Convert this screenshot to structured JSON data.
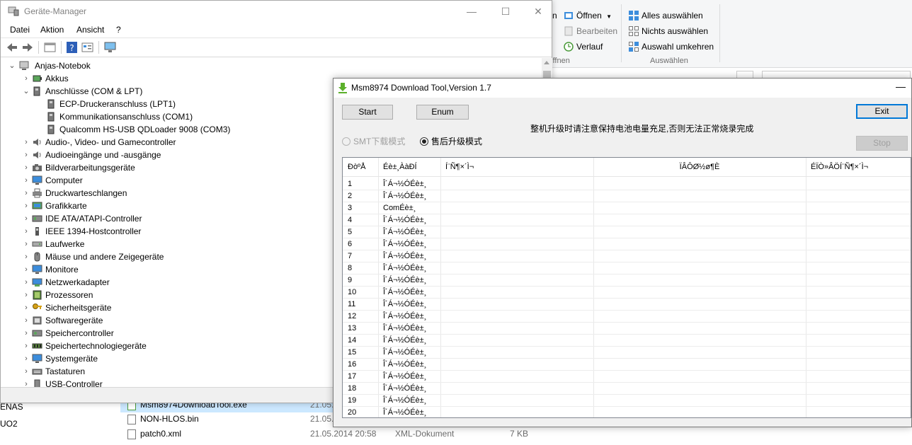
{
  "explorer": {
    "ribbon": {
      "open_label": "Öffnen",
      "edit_label": "Bearbeiten",
      "history_label": "Verlauf",
      "open_group_caption": "Öffnen",
      "select_all_label": "Alles auswählen",
      "select_none_label": "Nichts auswählen",
      "invert_selection_label": "Auswahl umkehren",
      "select_group_caption": "Auswählen",
      "new_partial": "n"
    },
    "nav_items": [
      "ENAS",
      "UO2"
    ],
    "files": [
      {
        "name": "Msm8974DownloadTool.exe",
        "date": "21.05.",
        "type": "",
        "size": ""
      },
      {
        "name": "NON-HLOS.bin",
        "date": "21.05.",
        "type": "",
        "size": ""
      },
      {
        "name": "patch0.xml",
        "date": "21.05.2014 20:58",
        "type": "XML-Dokument",
        "size": "7 KB"
      }
    ]
  },
  "devmgr": {
    "title": "Geräte-Manager",
    "menu": [
      "Datei",
      "Aktion",
      "Ansicht",
      "?"
    ],
    "window_controls": {
      "minimize": "—",
      "maximize": "☐",
      "close": "✕"
    },
    "tree": {
      "root": "Anjas-Notebok",
      "categories": [
        {
          "label": "Akkus",
          "expanded": false
        },
        {
          "label": "Anschlüsse (COM & LPT)",
          "expanded": true,
          "children": [
            "ECP-Druckeranschluss (LPT1)",
            "Kommunikationsanschluss (COM1)",
            "Qualcomm HS-USB QDLoader 9008 (COM3)"
          ]
        },
        {
          "label": "Audio-, Video- und Gamecontroller",
          "expanded": false
        },
        {
          "label": "Audioeingänge und -ausgänge",
          "expanded": false
        },
        {
          "label": "Bildverarbeitungsgeräte",
          "expanded": false
        },
        {
          "label": "Computer",
          "expanded": false
        },
        {
          "label": "Druckwarteschlangen",
          "expanded": false
        },
        {
          "label": "Grafikkarte",
          "expanded": false
        },
        {
          "label": "IDE ATA/ATAPI-Controller",
          "expanded": false
        },
        {
          "label": "IEEE 1394-Hostcontroller",
          "expanded": false
        },
        {
          "label": "Laufwerke",
          "expanded": false
        },
        {
          "label": "Mäuse und andere Zeigegeräte",
          "expanded": false
        },
        {
          "label": "Monitore",
          "expanded": false
        },
        {
          "label": "Netzwerkadapter",
          "expanded": false
        },
        {
          "label": "Prozessoren",
          "expanded": false
        },
        {
          "label": "Sicherheitsgeräte",
          "expanded": false
        },
        {
          "label": "Softwaregeräte",
          "expanded": false
        },
        {
          "label": "Speichercontroller",
          "expanded": false
        },
        {
          "label": "Speichertechnologiegeräte",
          "expanded": false
        },
        {
          "label": "Systemgeräte",
          "expanded": false
        },
        {
          "label": "Tastaturen",
          "expanded": false
        },
        {
          "label": "USB-Controller",
          "expanded": false
        }
      ]
    }
  },
  "dltool": {
    "title": "Msm8974 Download Tool,Version 1.7",
    "minimize": "—",
    "start_label": "Start",
    "enum_label": "Enum",
    "exit_label": "Exit",
    "stop_label": "Stop",
    "warning": "整机升级时请注意保持电池电量充足,否则无法正常烧录完成",
    "mode_smt": "SMT下载模式",
    "mode_aftersale": "售后升级模式",
    "selected_mode": "aftersale",
    "grid": {
      "headers": [
        "ÐòºÅ",
        "Éè±¸ÀàÐÍ",
        "Í¨Ñ¶×´Ì¬",
        "ÏÂÔØ½ø¶È",
        "ÉÏÒ»ÂÖÍ¨Ñ¶×´Ì¬"
      ],
      "rows": [
        {
          "no": "1",
          "type": "Î´Á¬½ÓÉè±¸"
        },
        {
          "no": "2",
          "type": "Î´Á¬½ÓÉè±¸"
        },
        {
          "no": "3",
          "type": "ComÉè±¸"
        },
        {
          "no": "4",
          "type": "Î´Á¬½ÓÉè±¸"
        },
        {
          "no": "5",
          "type": "Î´Á¬½ÓÉè±¸"
        },
        {
          "no": "6",
          "type": "Î´Á¬½ÓÉè±¸"
        },
        {
          "no": "7",
          "type": "Î´Á¬½ÓÉè±¸"
        },
        {
          "no": "8",
          "type": "Î´Á¬½ÓÉè±¸"
        },
        {
          "no": "9",
          "type": "Î´Á¬½ÓÉè±¸"
        },
        {
          "no": "10",
          "type": "Î´Á¬½ÓÉè±¸"
        },
        {
          "no": "11",
          "type": "Î´Á¬½ÓÉè±¸"
        },
        {
          "no": "12",
          "type": "Î´Á¬½ÓÉè±¸"
        },
        {
          "no": "13",
          "type": "Î´Á¬½ÓÉè±¸"
        },
        {
          "no": "14",
          "type": "Î´Á¬½ÓÉè±¸"
        },
        {
          "no": "15",
          "type": "Î´Á¬½ÓÉè±¸"
        },
        {
          "no": "16",
          "type": "Î´Á¬½ÓÉè±¸"
        },
        {
          "no": "17",
          "type": "Î´Á¬½ÓÉè±¸"
        },
        {
          "no": "18",
          "type": "Î´Á¬½ÓÉè±¸"
        },
        {
          "no": "19",
          "type": "Î´Á¬½ÓÉè±¸"
        },
        {
          "no": "20",
          "type": "Î´Á¬½ÓÉè±¸"
        }
      ]
    }
  }
}
